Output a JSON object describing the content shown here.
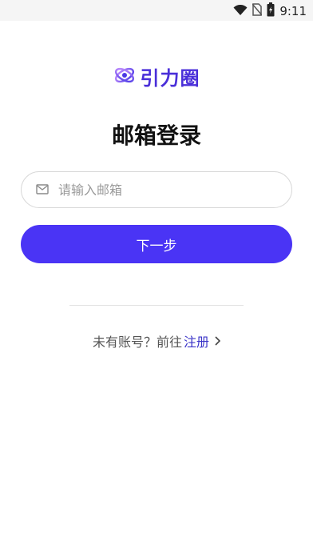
{
  "status_bar": {
    "time": "9:11"
  },
  "logo": {
    "text": "引力圈"
  },
  "page": {
    "title": "邮箱登录"
  },
  "email_input": {
    "placeholder": "请输入邮箱",
    "value": ""
  },
  "actions": {
    "next_label": "下一步"
  },
  "footer": {
    "no_account_text": "未有账号？前往",
    "register_label": "注册"
  },
  "colors": {
    "accent": "#4a34f5",
    "link": "#3b34c8"
  },
  "icons": [
    "wifi-icon",
    "no-sim-icon",
    "battery-icon",
    "logo-icon",
    "mail-icon",
    "chevron-right-icon"
  ]
}
